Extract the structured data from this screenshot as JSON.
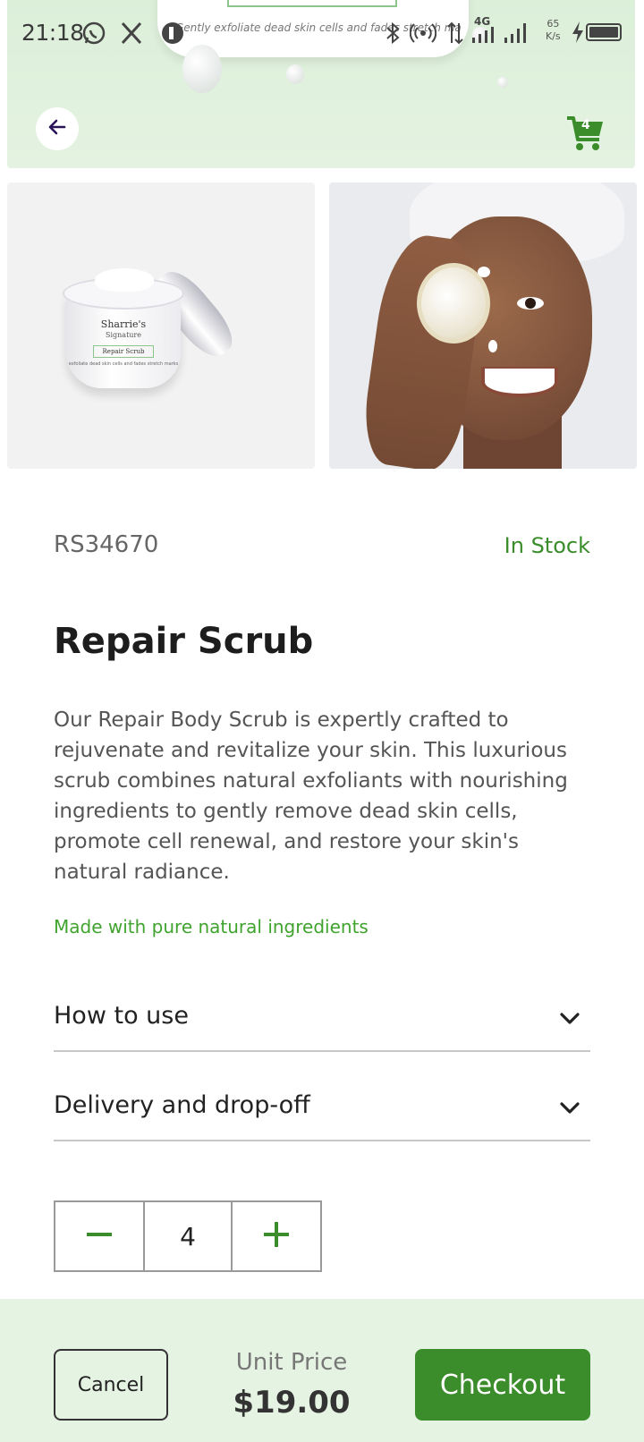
{
  "status_bar": {
    "time": "21:18",
    "network_type": "4G",
    "speed_value": "65",
    "speed_unit": "K/s",
    "icons": [
      "whatsapp-icon",
      "x-icon",
      "notification-icon",
      "bluetooth-icon",
      "hotspot-icon",
      "data-arrows-icon",
      "signal-icon",
      "signal-icon-2",
      "charging-icon",
      "battery-icon"
    ]
  },
  "hero": {
    "jar_tagline": "Gently exfoliate dead skin cells and fades stretch marks"
  },
  "header": {
    "back_icon": "arrow-left-icon",
    "cart_icon": "cart-icon",
    "cart_count": "4"
  },
  "gallery": {
    "jar_brand": "Sharrie's",
    "jar_brand_sub": "Signature",
    "jar_product": "Repair Scrub",
    "jar_tagline": "exfoliate dead skin cells and fades stretch marks"
  },
  "product": {
    "sku": "RS34670",
    "stock_status": "In Stock",
    "name": "Repair Scrub",
    "description": "Our Repair Body Scrub is expertly crafted to rejuvenate and revitalize your skin. This luxurious scrub combines natural exfoliants with nourishing ingredients to gently remove dead skin cells, promote cell renewal, and restore your skin's natural radiance.",
    "natural_note": "Made with pure natural ingredients"
  },
  "accordions": [
    {
      "label": "How to use"
    },
    {
      "label": "Delivery and drop-off"
    }
  ],
  "quantity": {
    "value": "4"
  },
  "footer": {
    "cancel_label": "Cancel",
    "unit_price_label": "Unit Price",
    "unit_price": "$19.00",
    "checkout_label": "Checkout"
  },
  "colors": {
    "accent": "#3b8c2a",
    "hero_bg": "#dcefd9",
    "footer_bg": "#e5f3e2"
  }
}
